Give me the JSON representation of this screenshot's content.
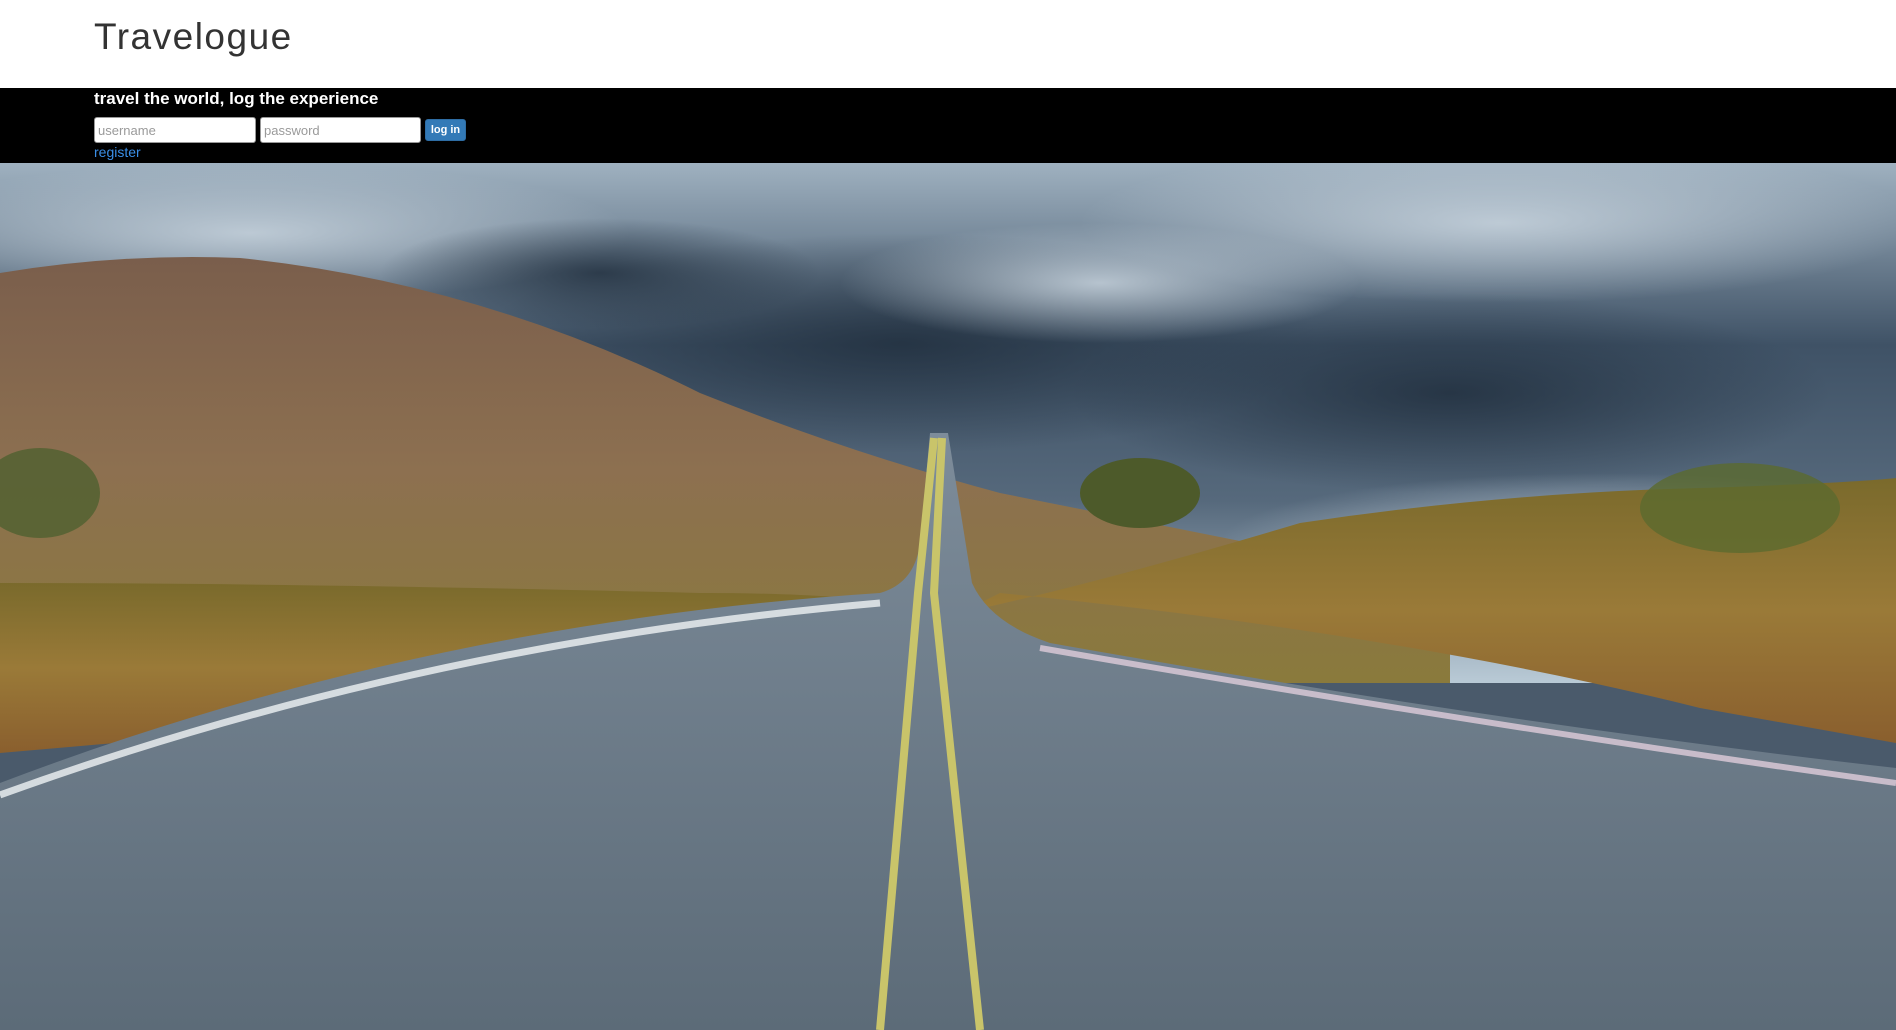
{
  "header": {
    "brand": "Travelogue"
  },
  "topbar": {
    "tagline": "travel the world, log the experience",
    "username_placeholder": "username",
    "password_placeholder": "password",
    "login_label": "log in",
    "register_label": "register"
  },
  "hero": {
    "scene": "road-landscape-image"
  },
  "colors": {
    "bar": "#000000",
    "button": "#337ab7",
    "link": "#3a8ee6",
    "brand_text": "#333333"
  }
}
